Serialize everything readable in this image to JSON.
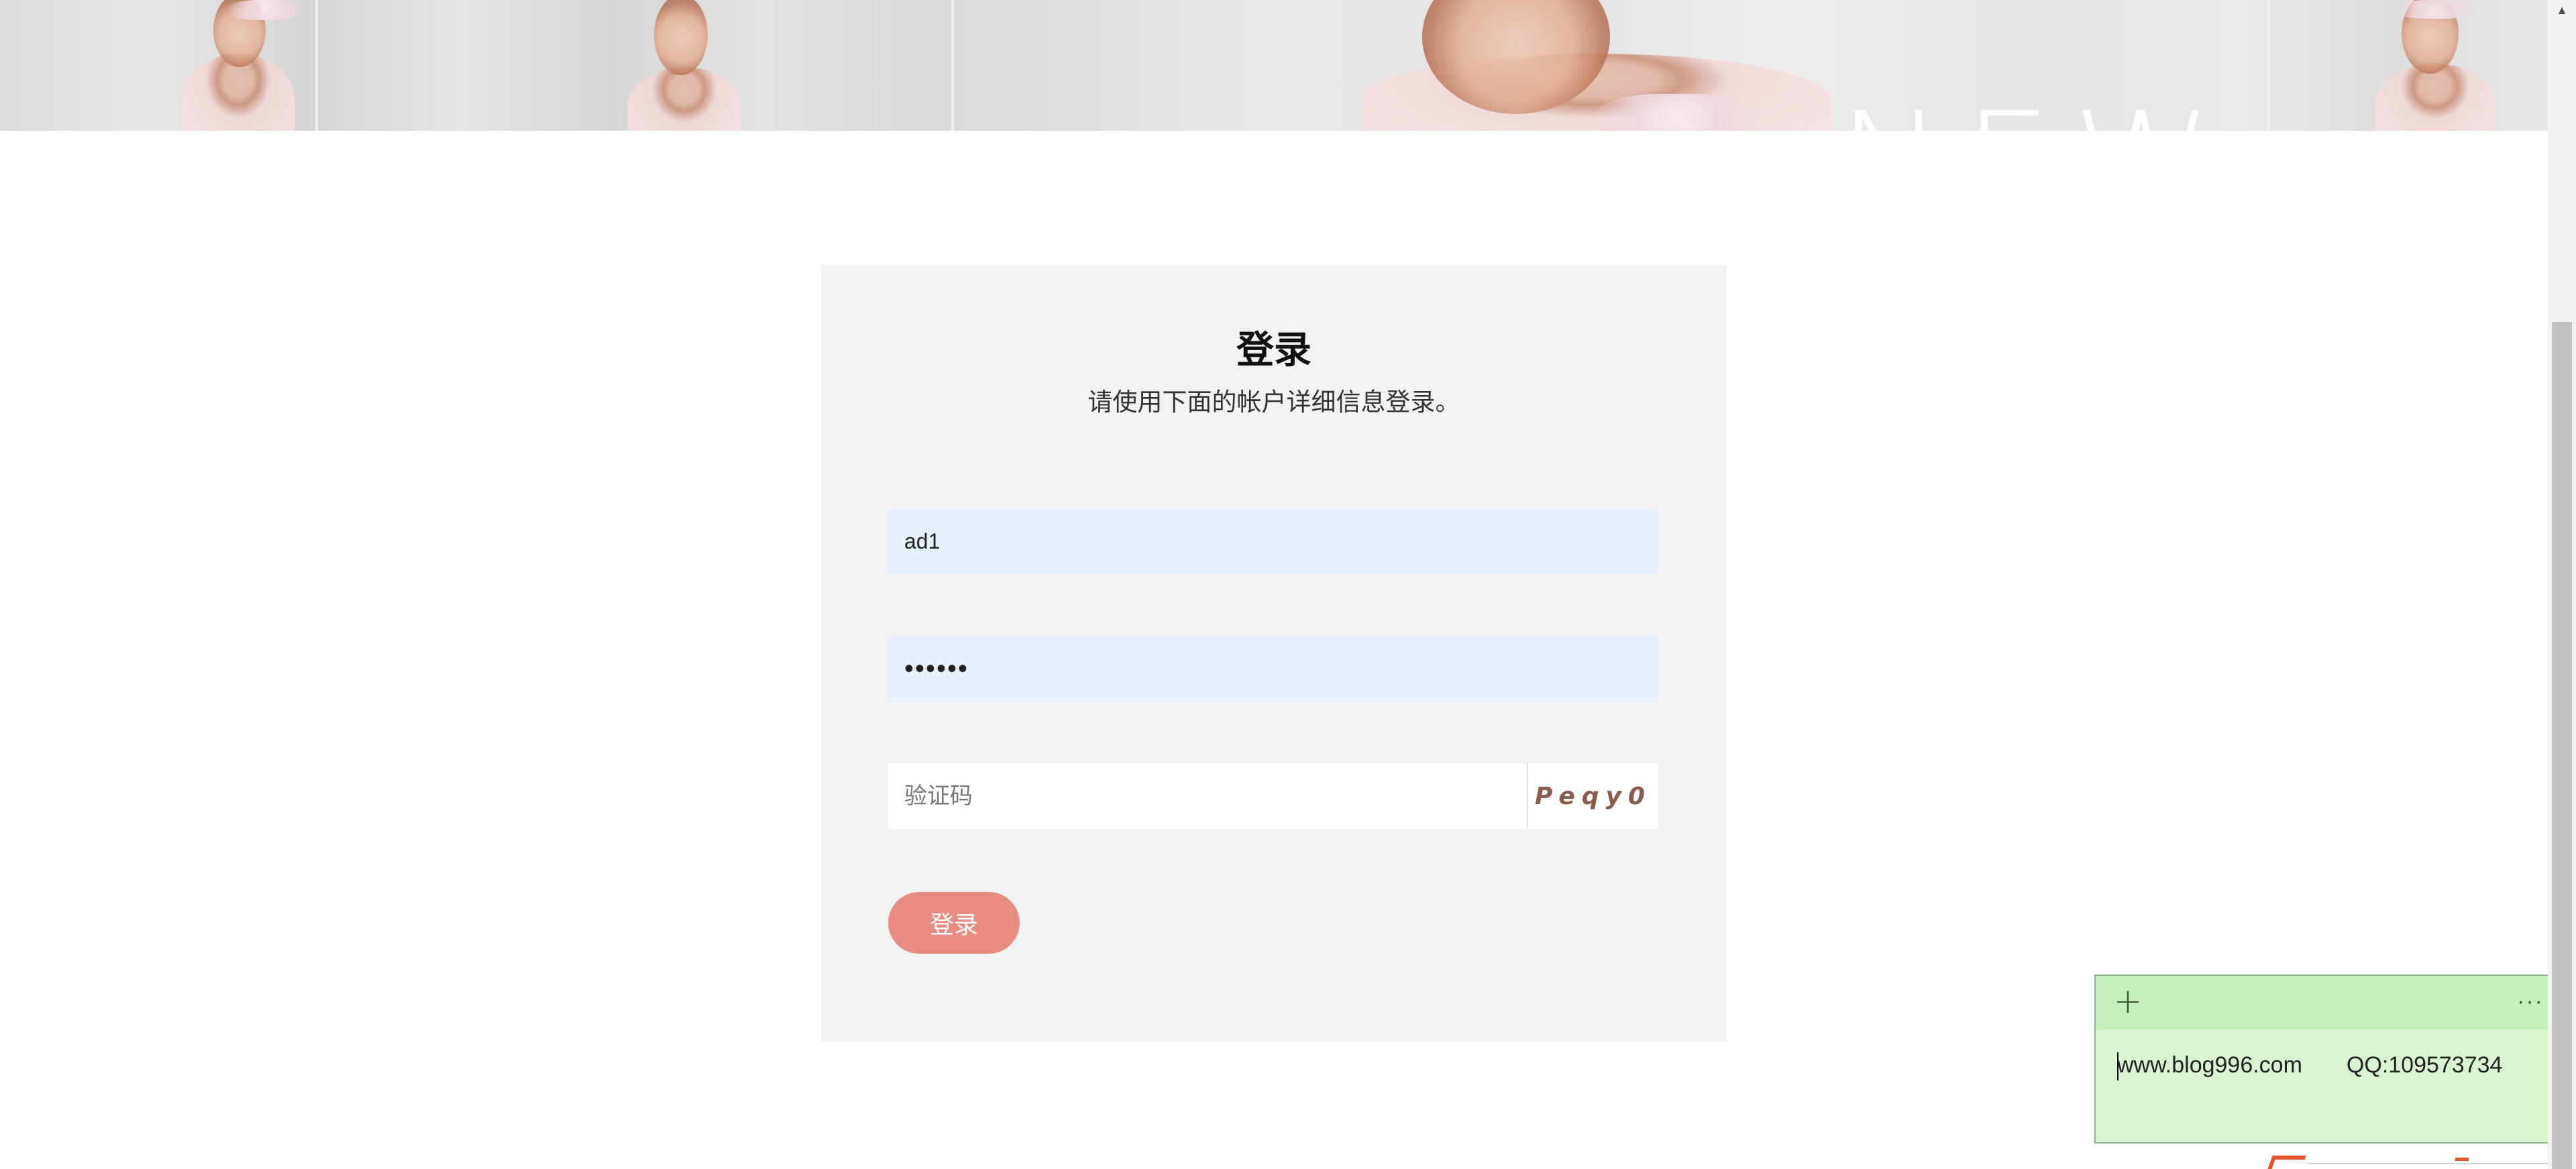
{
  "banner": {
    "overlay_text": "NEW"
  },
  "login": {
    "title": "登录",
    "subtitle": "请使用下面的帐户详细信息登录。",
    "username_value": "ad1",
    "password_value": "••••••",
    "captcha_placeholder": "验证码",
    "captcha_code": "Peqy0",
    "submit_label": "登录",
    "colors": {
      "card_background": "#f2f2f2",
      "autofill_background": "#e8f0fe",
      "button": "#e88c82",
      "captcha_text": "#8a5a4b"
    }
  },
  "sticky_note": {
    "add_icon": "plus-icon",
    "more_icon": "ellipsis-icon",
    "close_icon": "close-icon",
    "line_website": "www.blog996.com",
    "line_qq": "QQ:109573734",
    "colors": {
      "body": "#d7f5cf",
      "toolbar": "#c6efbd"
    }
  },
  "scrollbar": {
    "up_icon": "scroll-up-arrow-icon"
  }
}
